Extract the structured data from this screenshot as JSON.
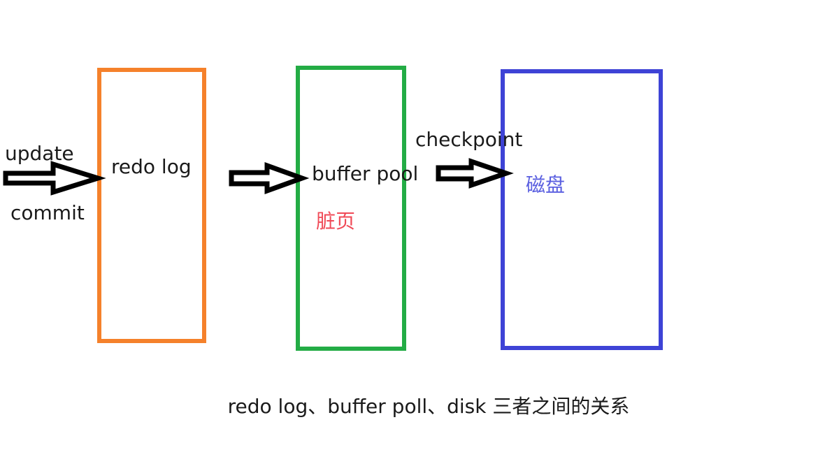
{
  "labels": {
    "update": "update",
    "commit": "commit",
    "redo_log": "redo log",
    "buffer_pool": "buffer pool",
    "dirty_page": "脏页",
    "checkpoint": "checkpoint",
    "disk": "磁盘"
  },
  "caption": "redo log、buffer poll、disk 三者之间的关系",
  "colors": {
    "redo_log_box": "#f5812b",
    "buffer_pool_box": "#23ac45",
    "disk_box": "#3e43d6",
    "dirty_page_text": "#f04a57",
    "disk_text": "#5a5fe0",
    "arrow_stroke": "#000000",
    "text": "#1a1a1a"
  },
  "icons": {
    "arrow": "block-arrow-right"
  }
}
